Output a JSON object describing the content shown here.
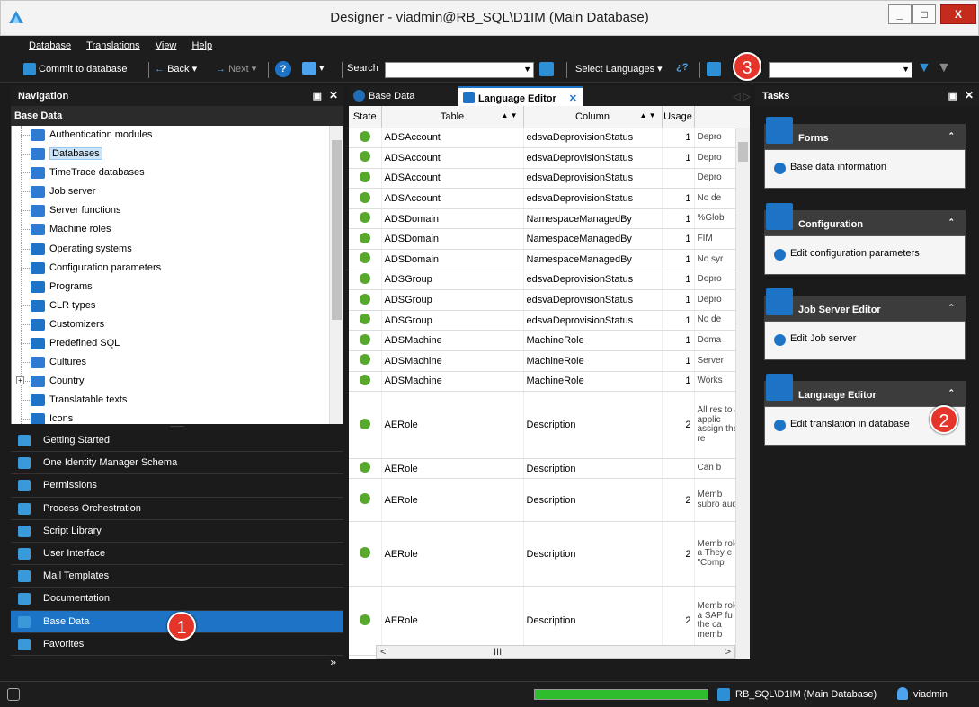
{
  "window": {
    "title": "Designer - viadmin@RB_SQL\\D1IM (Main Database)"
  },
  "menu": [
    "Database",
    "Translations",
    "View",
    "Help"
  ],
  "toolbar": {
    "commit": "Commit to database",
    "back": "Back",
    "next": "Next",
    "search_label": "Search",
    "select_languages": "Select Languages"
  },
  "navigation": {
    "title": "Navigation",
    "section": "Base Data",
    "tree": [
      {
        "label": "Authentication modules",
        "color": "#2f7bd1"
      },
      {
        "label": "Databases",
        "color": "#2f7bd1",
        "selected": true
      },
      {
        "label": "TimeTrace databases",
        "color": "#2f7bd1"
      },
      {
        "label": "Job server",
        "color": "#2f7bd1"
      },
      {
        "label": "Server functions",
        "color": "#2f7bd1"
      },
      {
        "label": "Machine roles",
        "color": "#2f7bd1"
      },
      {
        "label": "Operating systems",
        "color": "#1d74c6"
      },
      {
        "label": "Configuration parameters",
        "color": "#1d74c6"
      },
      {
        "label": "Programs",
        "color": "#1d74c6"
      },
      {
        "label": "CLR types",
        "color": "#1d74c6"
      },
      {
        "label": "Customizers",
        "color": "#1d74c6"
      },
      {
        "label": "Predefined SQL",
        "color": "#1d74c6"
      },
      {
        "label": "Cultures",
        "color": "#2f7bd1"
      },
      {
        "label": "Country",
        "color": "#2f7bd1"
      },
      {
        "label": "Translatable texts",
        "color": "#1d74c6"
      },
      {
        "label": "Icons",
        "color": "#1d74c6"
      }
    ],
    "categories": [
      {
        "label": "Getting Started",
        "active": false
      },
      {
        "label": "One Identity Manager Schema",
        "active": false
      },
      {
        "label": "Permissions",
        "active": false
      },
      {
        "label": "Process Orchestration",
        "active": false
      },
      {
        "label": "Script Library",
        "active": false
      },
      {
        "label": "User Interface",
        "active": false
      },
      {
        "label": "Mail Templates",
        "active": false
      },
      {
        "label": "Documentation",
        "active": false
      },
      {
        "label": "Base Data",
        "active": true
      },
      {
        "label": "Favorites",
        "active": false
      }
    ]
  },
  "editor": {
    "tabs": [
      "Base Data",
      "Language Editor"
    ],
    "columns": [
      "State",
      "Table",
      "Column",
      "Usage"
    ],
    "rows": [
      {
        "table": "ADSAccount",
        "column": "edsvaDeprovisionStatus",
        "usage": "1",
        "text": "Depro",
        "h": 1
      },
      {
        "table": "ADSAccount",
        "column": "edsvaDeprovisionStatus",
        "usage": "1",
        "text": "Depro",
        "h": 1
      },
      {
        "table": "ADSAccount",
        "column": "edsvaDeprovisionStatus",
        "usage": "",
        "text": "Depro",
        "h": 1
      },
      {
        "table": "ADSAccount",
        "column": "edsvaDeprovisionStatus",
        "usage": "1",
        "text": "No de",
        "h": 1
      },
      {
        "table": "ADSDomain",
        "column": "NamespaceManagedBy",
        "usage": "1",
        "text": "%Glob",
        "h": 1
      },
      {
        "table": "ADSDomain",
        "column": "NamespaceManagedBy",
        "usage": "1",
        "text": "FIM",
        "h": 1
      },
      {
        "table": "ADSDomain",
        "column": "NamespaceManagedBy",
        "usage": "1",
        "text": "No syr",
        "h": 1
      },
      {
        "table": "ADSGroup",
        "column": "edsvaDeprovisionStatus",
        "usage": "1",
        "text": "Depro",
        "h": 1
      },
      {
        "table": "ADSGroup",
        "column": "edsvaDeprovisionStatus",
        "usage": "1",
        "text": "Depro",
        "h": 1
      },
      {
        "table": "ADSGroup",
        "column": "edsvaDeprovisionStatus",
        "usage": "1",
        "text": "No de",
        "h": 1
      },
      {
        "table": "ADSMachine",
        "column": "MachineRole",
        "usage": "1",
        "text": "Doma",
        "h": 1
      },
      {
        "table": "ADSMachine",
        "column": "MachineRole",
        "usage": "1",
        "text": "Server",
        "h": 1
      },
      {
        "table": "ADSMachine",
        "column": "MachineRole",
        "usage": "1",
        "text": "Works",
        "h": 1
      },
      {
        "table": "AERole",
        "column": "Description",
        "usage": "2",
        "text": "All res to all applic assign the re",
        "h": 3.3
      },
      {
        "table": "AERole",
        "column": "Description",
        "usage": "",
        "text": "Can b",
        "h": 1
      },
      {
        "table": "AERole",
        "column": "Description",
        "usage": "2",
        "text": "Memb subro auditi",
        "h": 2.1
      },
      {
        "table": "AERole",
        "column": "Description",
        "usage": "2",
        "text": "Memb roles a They e \"Comp",
        "h": 3.2
      },
      {
        "table": "AERole",
        "column": "Description",
        "usage": "2",
        "text": "Memb roles a SAP fu the ca memb",
        "h": 3.4
      },
      {
        "table": "",
        "column": "",
        "usage": "",
        "text": "Memb roles a",
        "h": 1.2
      },
      {
        "table": "",
        "column": "",
        "usage": "",
        "text": "",
        "h": 1
      }
    ]
  },
  "tasks": {
    "title": "Tasks",
    "groups": [
      {
        "header": "Forms",
        "item": "Base data information"
      },
      {
        "header": "Configuration",
        "item": "Edit configuration parameters"
      },
      {
        "header": "Job Server Editor",
        "item": "Edit Job server"
      },
      {
        "header": "Language Editor",
        "item": "Edit translation in database"
      }
    ]
  },
  "callouts": [
    "1",
    "2",
    "3"
  ],
  "status": {
    "database": "RB_SQL\\D1IM (Main Database)",
    "user": "viadmin",
    "progress": 1.0
  },
  "colors": {
    "accent": "#1d74c6",
    "state_ok": "#57a82d",
    "callout": "#e5352b"
  }
}
